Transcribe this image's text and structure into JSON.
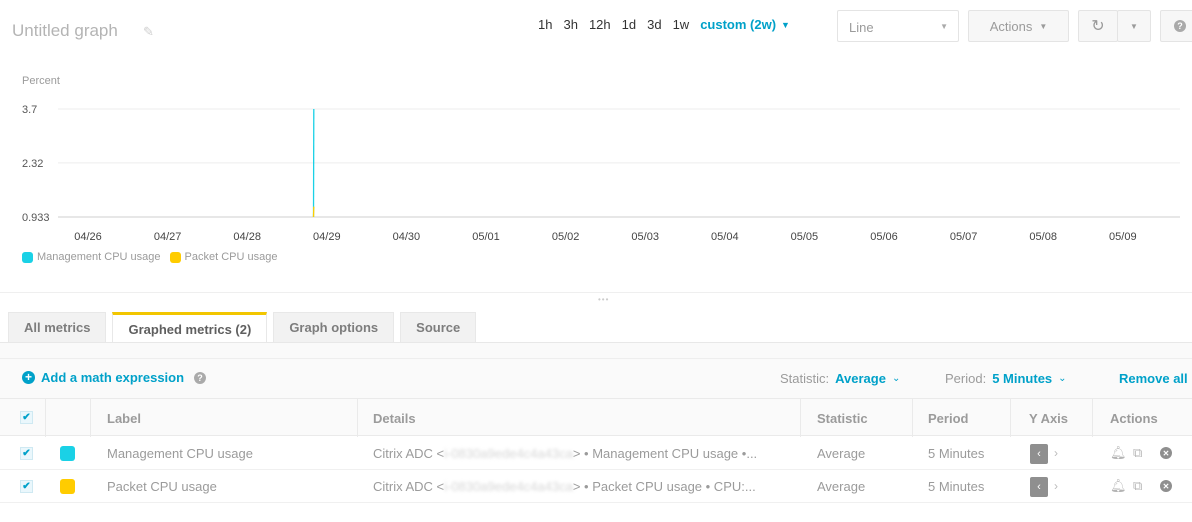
{
  "header": {
    "title": "Untitled graph",
    "time_ranges": [
      "1h",
      "3h",
      "12h",
      "1d",
      "3d",
      "1w"
    ],
    "custom_range": "custom (2w)",
    "graph_type_select": "Line",
    "actions_label": "Actions"
  },
  "chart_data": {
    "type": "line",
    "ylabel": "Percent",
    "yticks": [
      "3.7",
      "2.32",
      "0.933"
    ],
    "ylim": [
      0.933,
      3.7
    ],
    "x_tick_labels": [
      "04/26",
      "04/27",
      "04/28",
      "04/29",
      "04/30",
      "05/01",
      "05/02",
      "05/03",
      "05/04",
      "05/05",
      "05/06",
      "05/07",
      "05/08",
      "05/09"
    ],
    "grid": true,
    "legend_position": "bottom-left",
    "series": [
      {
        "name": "Management CPU usage",
        "color": "#1ad1e6",
        "x": [
          "04/28 20:00",
          "04/28 20:05"
        ],
        "values": [
          0.933,
          3.7
        ]
      },
      {
        "name": "Packet CPU usage",
        "color": "#ffcc00",
        "x": [
          "04/28 20:00",
          "04/28 20:05"
        ],
        "values": [
          0.933,
          1.2
        ]
      }
    ]
  },
  "tabs": [
    "All metrics",
    "Graphed metrics (2)",
    "Graph options",
    "Source"
  ],
  "toolbar": {
    "add_math": "Add a math expression",
    "statistic_label": "Statistic:",
    "statistic_value": "Average",
    "period_label": "Period:",
    "period_value": "5 Minutes",
    "remove_all": "Remove all"
  },
  "table": {
    "headers": {
      "label": "Label",
      "details": "Details",
      "statistic": "Statistic",
      "period": "Period",
      "yaxis": "Y Axis",
      "actions": "Actions"
    },
    "rows": [
      {
        "color": "#1ad1e6",
        "label": "Management CPU usage",
        "details_prefix": "Citrix ADC <",
        "details_masked": "i-0830a9ede4c4a43ca",
        "details_suffix": "> • Management CPU usage •...",
        "statistic": "Average",
        "period": "5 Minutes"
      },
      {
        "color": "#ffcc00",
        "label": "Packet CPU usage",
        "details_prefix": "Citrix ADC <",
        "details_masked": "i-0830a9ede4c4a43ca",
        "details_suffix": "> • Packet CPU usage • CPU:...",
        "statistic": "Average",
        "period": "5 Minutes"
      }
    ]
  }
}
